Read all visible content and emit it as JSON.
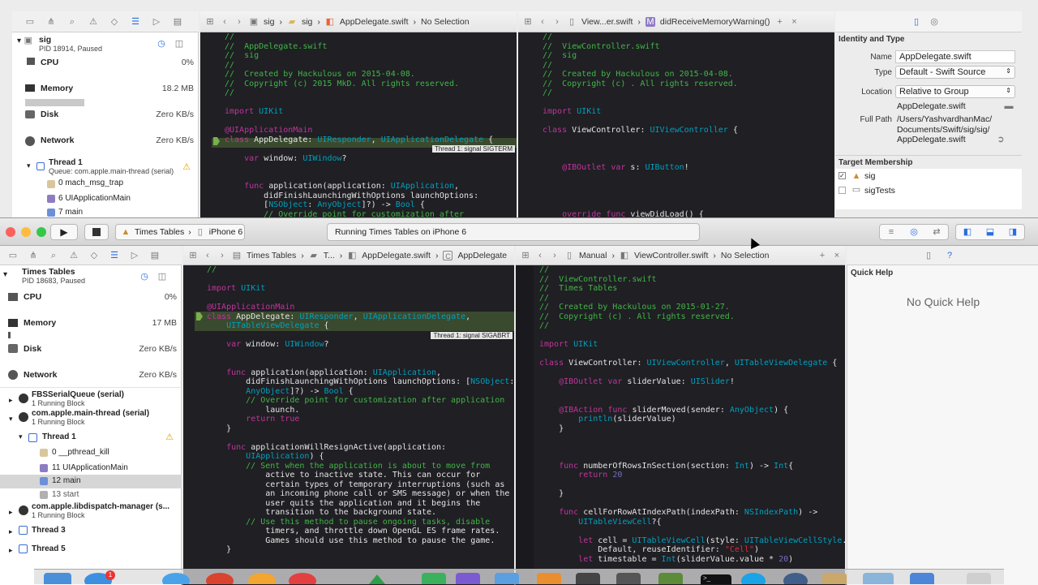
{
  "top": {
    "crumb_left": [
      "sig",
      "sig",
      "AppDelegate.swift",
      "No Selection"
    ],
    "crumb_right": [
      "View...er.swift",
      "didReceiveMemoryWarning()"
    ],
    "debug": {
      "proc": "sig",
      "pid": "PID 18914, Paused",
      "cpu": "CPU",
      "cpu_v": "0%",
      "mem": "Memory",
      "mem_v": "18.2 MB",
      "disk": "Disk",
      "disk_v": "Zero KB/s",
      "net": "Network",
      "net_v": "Zero KB/s",
      "thread": "Thread 1",
      "queue": "Queue: com.apple.main-thread (serial)",
      "frames": [
        "0 mach_msg_trap",
        "6 UIApplicationMain",
        "7 main"
      ]
    },
    "inspector": {
      "title": "Identity and Type",
      "name_l": "Name",
      "name": "AppDelegate.swift",
      "type_l": "Type",
      "type": "Default - Swift Source",
      "loc_l": "Location",
      "loc": "Relative to Group",
      "loc_file": "AppDelegate.swift",
      "path_l": "Full Path",
      "path": [
        "/Users/YashvardhanMac/",
        "Documents/Swift/sig/sig/",
        "AppDelegate.swift"
      ],
      "target": "Target Membership",
      "targets": [
        "sig",
        "sigTests"
      ]
    },
    "signal": "Thread 1: signal SIGTERM"
  },
  "win": {
    "toolbar": {
      "scheme": "Times Tables",
      "device": "iPhone 6",
      "status": "Running Times Tables on iPhone 6"
    },
    "crumb_left": [
      "Times Tables",
      "T...",
      "AppDelegate.swift",
      "AppDelegate"
    ],
    "crumb_right": [
      "Manual",
      "ViewController.swift",
      "No Selection"
    ],
    "debug": {
      "proc": "Times Tables",
      "pid": "PID 18683, Paused",
      "cpu": "CPU",
      "cpu_v": "0%",
      "mem": "Memory",
      "mem_v": "17 MB",
      "disk": "Disk",
      "disk_v": "Zero KB/s",
      "net": "Network",
      "net_v": "Zero KB/s"
    },
    "threads": {
      "q1": "FBSSerialQueue (serial)",
      "q1s": "1 Running Block",
      "q2": "com.apple.main-thread (serial)",
      "q2s": "1 Running Block",
      "t1": "Thread 1",
      "frames": [
        "0 __pthread_kill",
        "11 UIApplicationMain",
        "12 main",
        "13 start"
      ],
      "q3": "com.apple.libdispatch-manager (s...",
      "q3s": "1 Running Block",
      "t3": "Thread 3",
      "t5": "Thread 5"
    },
    "quickhelp": {
      "title": "Quick Help",
      "empty": "No Quick Help"
    },
    "signal": "Thread 1: signal SIGABRT"
  },
  "code": {
    "top_left": [
      "//",
      "//  AppDelegate.swift",
      "//  sig",
      "//",
      "//  Created by Hackulous on 2015-04-08.",
      "//  Copyright (c) 2015 MkD. All rights reserved.",
      "//",
      "",
      "import UIKit",
      "",
      "@UIApplicationMain",
      "class AppDelegate: UIResponder, UIApplicationDelegate {",
      "",
      "    var window: UIWindow?",
      "",
      "",
      "    func application(application: UIApplication,",
      "        didFinishLaunchingWithOptions launchOptions:",
      "        [NSObject: AnyObject]?) -> Bool {",
      "        // Override point for customization after"
    ],
    "top_right": [
      "//",
      "//  ViewController.swift",
      "//  sig",
      "//",
      "//  Created by Hackulous on 2015-04-08.",
      "//  Copyright (c) . All rights reserved.",
      "//",
      "",
      "import UIKit",
      "",
      "class ViewController: UIViewController {",
      "",
      "",
      "",
      "    @IBOutlet var s: UIButton!",
      "",
      "",
      "",
      "",
      "    override func viewDidLoad() {"
    ],
    "bot_left": [
      "//",
      "",
      "import UIKit",
      "",
      "@UIApplicationMain",
      "class AppDelegate: UIResponder, UIApplicationDelegate,",
      "    UITableViewDelegate {",
      "",
      "    var window: UIWindow?",
      "",
      "",
      "    func application(application: UIApplication,",
      "        didFinishLaunchingWithOptions launchOptions: [NSObject:",
      "        AnyObject]?) -> Bool {",
      "        // Override point for customization after application",
      "            launch.",
      "        return true",
      "    }",
      "",
      "    func applicationWillResignActive(application:",
      "        UIApplication) {",
      "        // Sent when the application is about to move from",
      "            active to inactive state. This can occur for",
      "            certain types of temporary interruptions (such as",
      "            an incoming phone call or SMS message) or when the",
      "            user quits the application and it begins the",
      "            transition to the background state.",
      "        // Use this method to pause ongoing tasks, disable",
      "            timers, and throttle down OpenGL ES frame rates.",
      "            Games should use this method to pause the game.",
      "    }"
    ],
    "bot_right": [
      "//",
      "//  ViewController.swift",
      "//  Times Tables",
      "//",
      "//  Created by Hackulous on 2015-01-27.",
      "//  Copyright (c) . All rights reserved.",
      "//",
      "",
      "import UIKit",
      "",
      "class ViewController: UIViewController, UITableViewDelegate {",
      "",
      "    @IBOutlet var sliderValue: UISlider!",
      "",
      "",
      "    @IBAction func sliderMoved(sender: AnyObject) {",
      "        println(sliderValue)",
      "    }",
      "",
      "",
      "",
      "    func numberOfRowsInSection(section: Int) -> Int{",
      "        return 20",
      "",
      "    }",
      "",
      "    func cellForRowAtIndexPath(indexPath: NSIndexPath) ->",
      "        UITableViewCell?{",
      "",
      "        let cell = UITableViewCell(style: UITableViewCellStyle.",
      "            Default, reuseIdentifier: \"Cell\")",
      "        let timestable = Int(sliderValue.value * 20)"
    ]
  },
  "colors": {
    "comment": "#41b645",
    "keyword": "#c2349b",
    "type": "#00a0be",
    "string": "#db2c38",
    "number": "#786dc4",
    "bg": "#1f1f24"
  }
}
